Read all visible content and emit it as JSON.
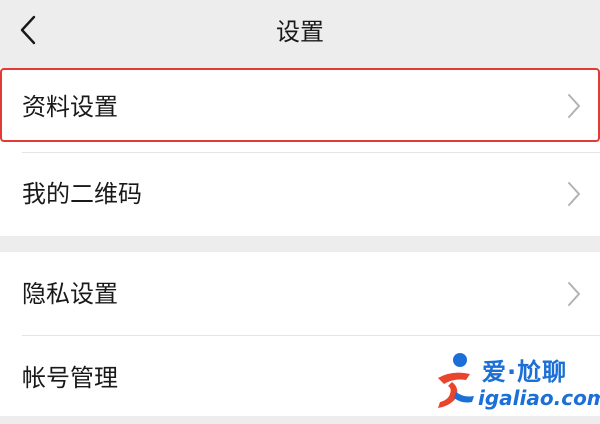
{
  "nav": {
    "title": "设置",
    "back_icon": "chevron-left-icon"
  },
  "groups": [
    {
      "items": [
        {
          "label": "资料设置",
          "highlighted": true
        },
        {
          "label": "我的二维码"
        }
      ]
    },
    {
      "items": [
        {
          "label": "隐私设置"
        },
        {
          "label": "帐号管理"
        }
      ]
    }
  ],
  "watermark": {
    "cn_text": "爱·尬聊",
    "url": "igaliao.com"
  },
  "colors": {
    "background": "#ededed",
    "card": "#ffffff",
    "highlight_border": "#e23b36",
    "watermark": "#1b6fd6"
  }
}
